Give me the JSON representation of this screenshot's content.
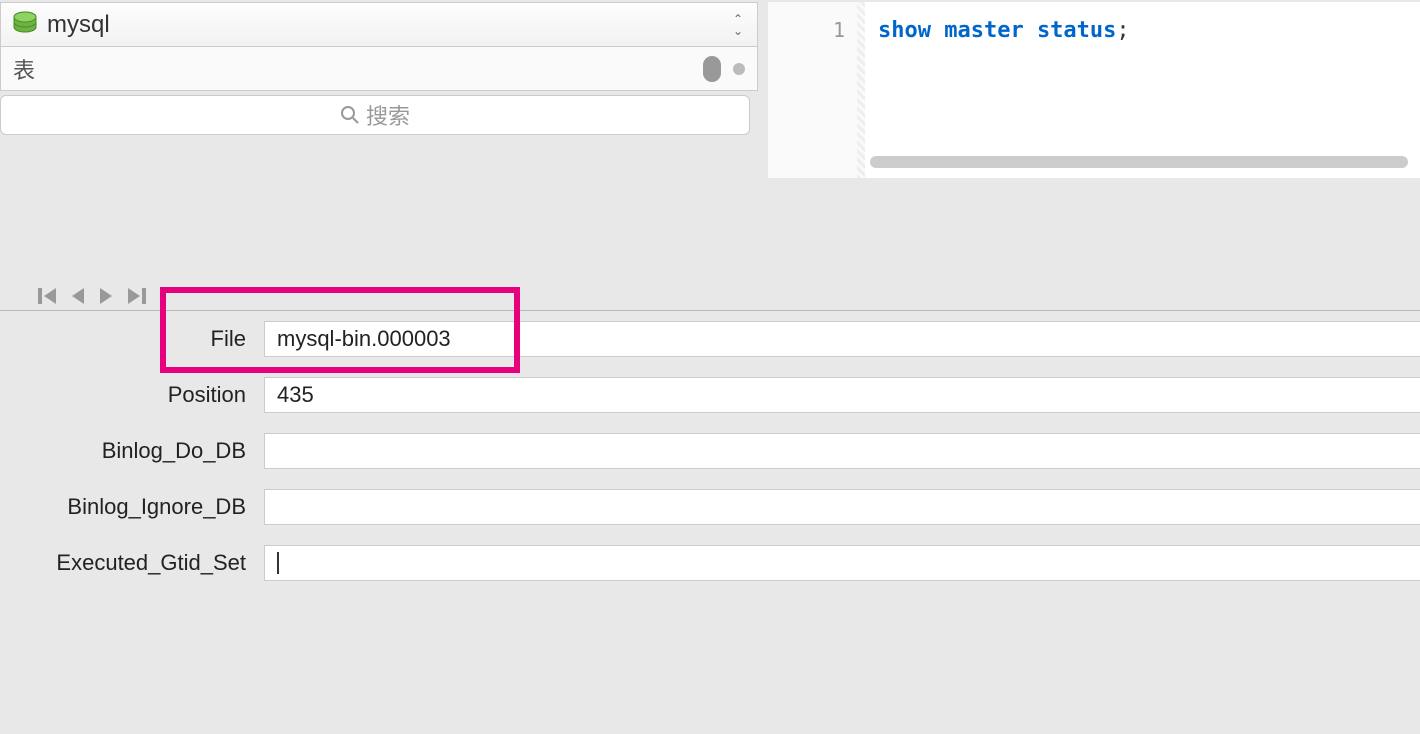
{
  "db": {
    "name": "mysql",
    "table_label": "表",
    "search_placeholder": "搜索"
  },
  "editor": {
    "line_number": "1",
    "sql_keywords": "show master status",
    "sql_punct": ";"
  },
  "results": {
    "fields": [
      {
        "label": "File",
        "value": "mysql-bin.000003"
      },
      {
        "label": "Position",
        "value": "435"
      },
      {
        "label": "Binlog_Do_DB",
        "value": ""
      },
      {
        "label": "Binlog_Ignore_DB",
        "value": ""
      },
      {
        "label": "Executed_Gtid_Set",
        "value": ""
      }
    ]
  }
}
